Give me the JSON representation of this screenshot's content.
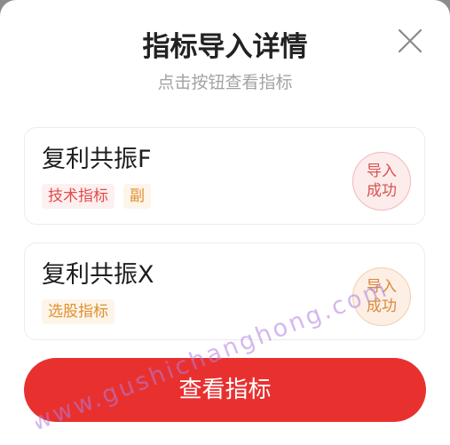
{
  "dialog": {
    "title": "指标导入详情",
    "subtitle": "点击按钮查看指标",
    "close_icon": "close-icon"
  },
  "cards": [
    {
      "name": "复利共振F",
      "tags": [
        "技术指标",
        "副"
      ],
      "status_line1": "导入",
      "status_line2": "成功"
    },
    {
      "name": "复利共振X",
      "tags": [
        "选股指标"
      ],
      "status_line1": "导入",
      "status_line2": "成功"
    }
  ],
  "cta": {
    "label": "查看指标"
  },
  "watermark": {
    "text": "www.gushichanghong.com"
  },
  "colors": {
    "accent": "#e8312f",
    "tag_red": "#e24b4b",
    "tag_orange": "#e0902f",
    "watermark": "#b07ee0"
  }
}
